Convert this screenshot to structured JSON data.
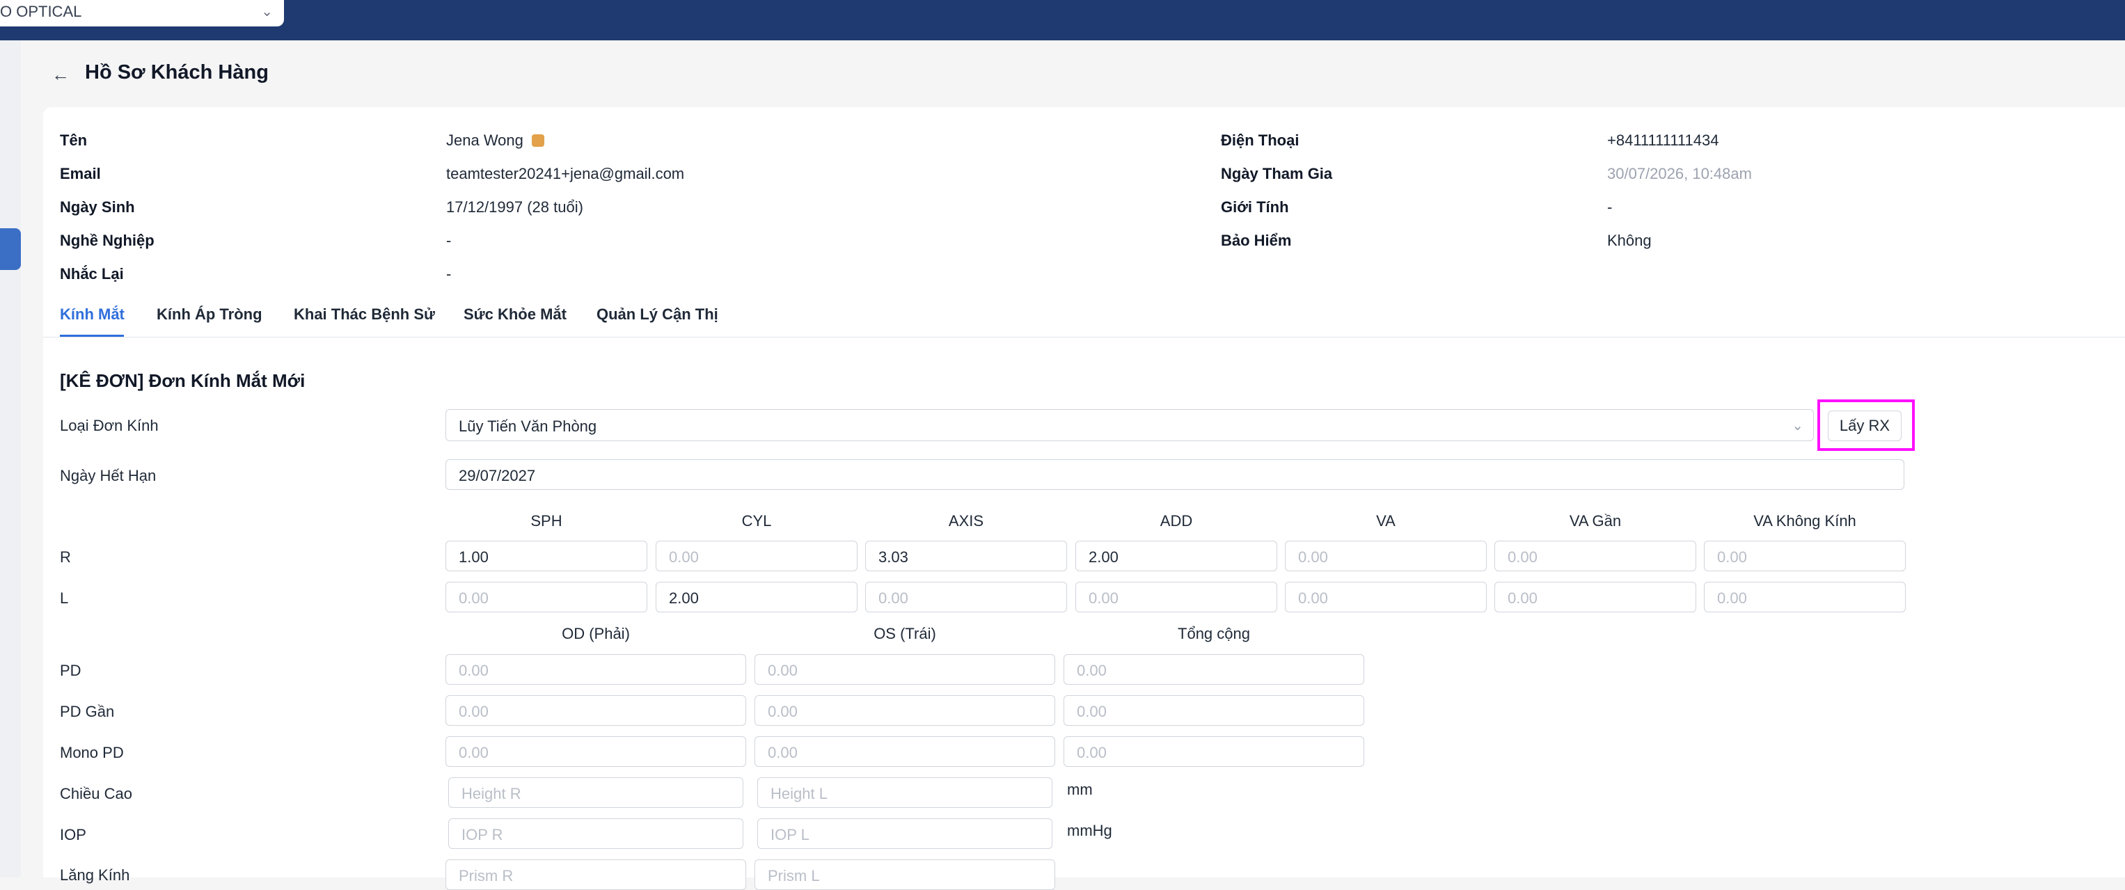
{
  "store": {
    "name": "O OPTICAL"
  },
  "header": {
    "title": "Hồ Sơ Khách Hàng"
  },
  "customer": {
    "left": [
      {
        "label": "Tên",
        "value": "Jena Wong"
      },
      {
        "label": "Email",
        "value": "teamtester20241+jena@gmail.com"
      },
      {
        "label": "Ngày Sinh",
        "value": "17/12/1997 (28 tuổi)"
      },
      {
        "label": "Nghề Nghiệp",
        "value": "-"
      },
      {
        "label": "Nhắc Lại",
        "value": "-"
      }
    ],
    "right": [
      {
        "label": "Điện Thoại",
        "value": "+8411111111434"
      },
      {
        "label": "Ngày Tham Gia",
        "value": "30/07/2026, 10:48am"
      },
      {
        "label": "Giới Tính",
        "value": "-"
      },
      {
        "label": "Bảo Hiểm",
        "value": "Không"
      }
    ],
    "tag_color": "#e3a14a"
  },
  "tabs": [
    "Kính Mắt",
    "Kính Áp Tròng",
    "Khai Thác Bệnh Sử",
    "Sức Khỏe Mắt",
    "Quản Lý Cận Thị"
  ],
  "active_tab": "Kính Mắt",
  "form": {
    "title": "[KÊ ĐƠN] Đơn Kính Mắt Mới",
    "lens_type_label": "Loại Đơn Kính",
    "lens_type_value": "Lũy Tiến Văn Phòng",
    "get_rx_button": "Lấy RX",
    "expiry_label": "Ngày Hết Hạn",
    "expiry_value": "29/07/2027",
    "rx_columns": [
      "SPH",
      "CYL",
      "AXIS",
      "ADD",
      "VA",
      "VA Gần",
      "VA Không Kính"
    ],
    "rx_rows": [
      {
        "label": "R",
        "values": [
          "1.00",
          "",
          "3.03",
          "2.00",
          "",
          "",
          ""
        ]
      },
      {
        "label": "L",
        "values": [
          "",
          "2.00",
          "",
          "",
          "",
          "",
          ""
        ]
      }
    ],
    "rx_placeholder": "0.00",
    "pd_columns": [
      "OD (Phải)",
      "OS (Trái)",
      "Tổng cộng"
    ],
    "pd_rows": [
      {
        "label": "PD",
        "placeholders": [
          "0.00",
          "0.00",
          "0.00"
        ]
      },
      {
        "label": "PD Gần",
        "placeholders": [
          "0.00",
          "0.00",
          "0.00"
        ]
      },
      {
        "label": "Mono PD",
        "placeholders": [
          "0.00",
          "0.00",
          "0.00"
        ]
      }
    ],
    "height": {
      "label": "Chiều Cao",
      "placeholders": [
        "Height R",
        "Height L"
      ],
      "unit": "mm"
    },
    "iop": {
      "label": "IOP",
      "placeholders": [
        "IOP R",
        "IOP L"
      ],
      "unit": "mmHg"
    },
    "prism": {
      "label": "Lăng Kính",
      "placeholders": [
        "Prism R",
        "Prism L"
      ]
    }
  },
  "colors": {
    "topbar": "#1e3a70",
    "accent": "#2f6fdc",
    "highlight": "#ff10ff"
  }
}
